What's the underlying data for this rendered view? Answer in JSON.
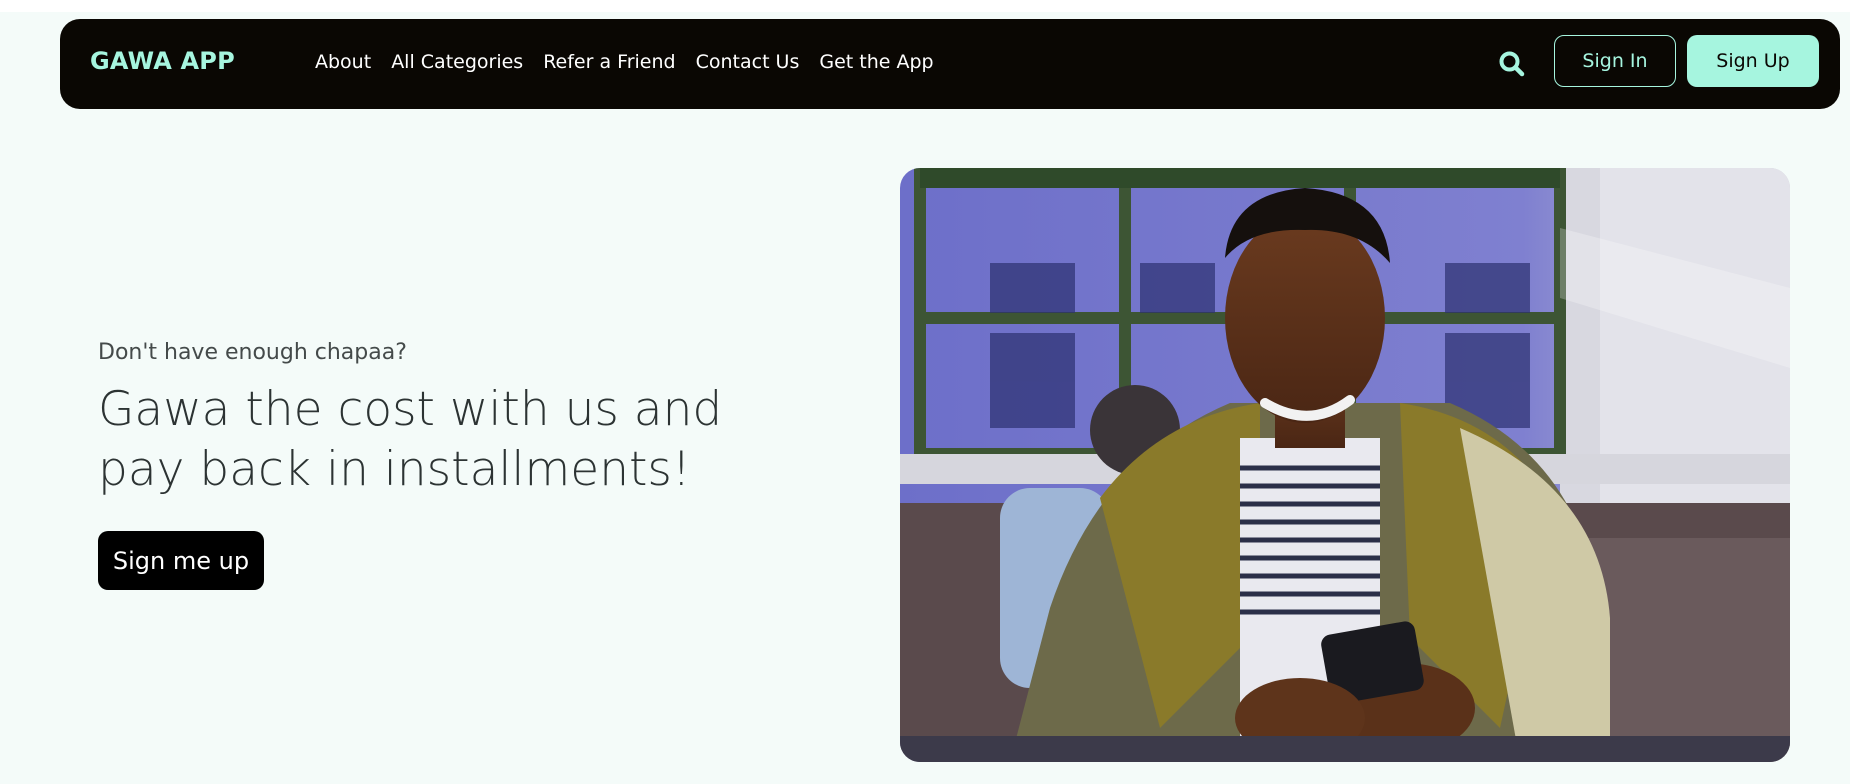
{
  "brand": {
    "name": "GAWA APP",
    "accent": "#a6f5df"
  },
  "nav": {
    "links": [
      "About",
      "All Categories",
      "Refer a Friend",
      "Contact Us",
      "Get the App"
    ],
    "search_icon": "search-icon",
    "sign_in": "Sign In",
    "sign_up": "Sign Up"
  },
  "hero": {
    "eyebrow": "Don't have enough chapaa?",
    "title": "Gawa the cost with us and pay back in installments!",
    "cta": "Sign me up"
  },
  "colors": {
    "navbar_bg": "#0a0703",
    "page_bg": "#f4fbf9",
    "cta_bg": "#000000"
  }
}
